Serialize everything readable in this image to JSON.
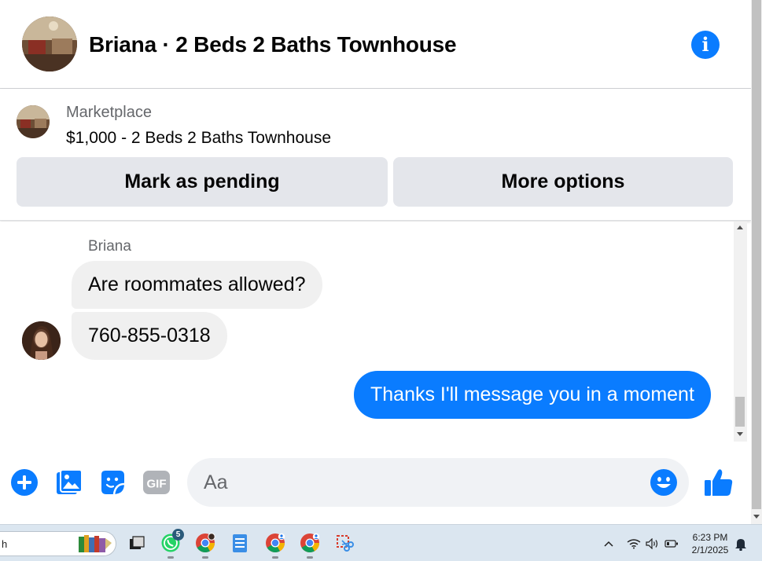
{
  "header": {
    "title": "Briana · 2 Beds 2 Baths Townhouse"
  },
  "marketplace": {
    "label": "Marketplace",
    "listing": "$1,000 - 2 Beds 2 Baths Townhouse",
    "pending_label": "Mark as pending",
    "more_label": "More options"
  },
  "conversation": {
    "sender": "Briana",
    "messages": [
      {
        "from": "Briana",
        "text": "Are roommates allowed?"
      },
      {
        "from": "Briana",
        "text": "760-855-0318"
      },
      {
        "from": "me",
        "text": "Thanks I'll message you in a moment"
      }
    ]
  },
  "composer": {
    "placeholder": "Aa",
    "gif_label": "GIF"
  },
  "taskbar": {
    "search_text": "h",
    "whatsapp_badge": "5",
    "time": "6:23 PM",
    "date": "2/1/2025"
  },
  "colors": {
    "accent": "#0a7cff",
    "bubble_in": "#f0f0f0",
    "button_bg": "#e4e6eb"
  }
}
